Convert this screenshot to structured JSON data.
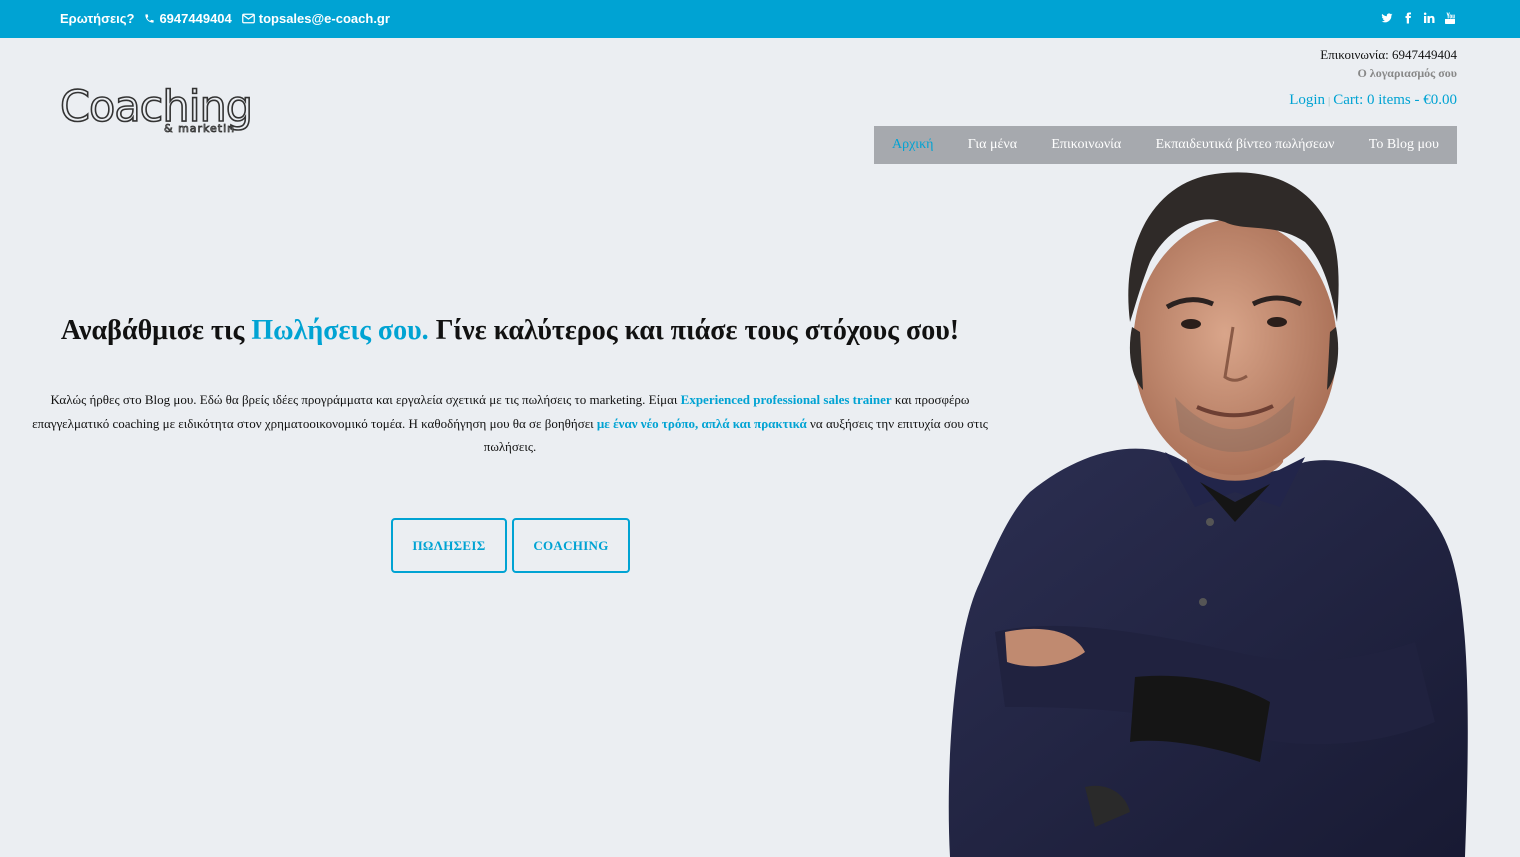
{
  "topbar": {
    "questions_label": "Ερωτήσεις?",
    "phone": "6947449404",
    "email": "topsales@e-coach.gr",
    "icons": [
      "phone-icon",
      "envelope-icon",
      "twitter-icon",
      "facebook-icon",
      "linkedin-icon",
      "youtube-icon"
    ]
  },
  "logo": {
    "main": "Coaching",
    "sub": "& marketin"
  },
  "header": {
    "contact": "Επικοινωνία: 6947449404",
    "account": "Ο λογαριασμός σου",
    "login": "Login",
    "separator": "|",
    "cart": "Cart: 0 items - €0.00"
  },
  "nav": {
    "items": [
      {
        "label": "Αρχική"
      },
      {
        "label": "Για μένα"
      },
      {
        "label": "Επικοινωνία"
      },
      {
        "label": "Εκπαιδευτικά βίντεο πωλήσεων"
      },
      {
        "label": "Το Blog μου"
      }
    ]
  },
  "hero": {
    "headline_pre": "Αναβάθμισε τις",
    "headline_accent": "Πωλήσεις σου.",
    "headline_post": "Γίνε καλύτερος και πιάσε τους στόχους σου!",
    "intro_1": "Καλώς ήρθες στο Blog μου. Εδώ θα βρείς ιδέες προγράμματα και εργαλεία σχετικά με τις πωλήσεις το marketing. Είμαι",
    "intro_accent_1": "Experienced professional sales trainer",
    "intro_2": "και προσφέρω επαγγελματικό coaching με ειδικότητα στον χρηματοοικονομικό τομέα. Η καθοδήγηση μου θα σε βοηθήσει",
    "intro_accent_2": "με έναν νέο τρόπο, απλά και πρακτικά",
    "intro_3": "να αυξήσεις την επιτυχία σου στις πωλήσεις.",
    "button_sales": "ΠΩΛΗΣΕΙΣ",
    "button_coaching": "COACHING"
  },
  "colors": {
    "accent": "#00a3d3",
    "nav_bg": "#a6a9ae",
    "page_bg": "#ebeef2"
  }
}
